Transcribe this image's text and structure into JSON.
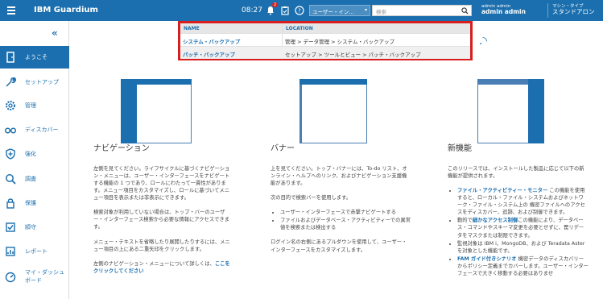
{
  "app": {
    "title": "IBM Guardium"
  },
  "topbar": {
    "time": "08:27",
    "notification_count": "2",
    "user_select_value": "ユーザー・イン…",
    "search_placeholder": "検索",
    "user_role": "admin admin",
    "user_name": "admin admin",
    "machine_type_label": "マシン・タイプ",
    "machine_type_value": "スタンドアロン"
  },
  "sidebar": {
    "items": [
      {
        "label": "ようこそ",
        "icon": "door-icon",
        "active": true
      },
      {
        "label": "セットアップ",
        "icon": "wrench-icon"
      },
      {
        "label": "管理",
        "icon": "gear-icon"
      },
      {
        "label": "ディスカバー",
        "icon": "binoculars-icon"
      },
      {
        "label": "強化",
        "icon": "shield-icon"
      },
      {
        "label": "調査",
        "icon": "magnifier-icon"
      },
      {
        "label": "保護",
        "icon": "lock-icon"
      },
      {
        "label": "順守",
        "icon": "checkbox-icon"
      },
      {
        "label": "レポート",
        "icon": "report-icon"
      },
      {
        "label": "マイ・ダッシュ",
        "label2": "ボード",
        "icon": "dashboard-icon"
      }
    ]
  },
  "popup": {
    "col_name": "NAME",
    "col_location": "LOCATION",
    "rows": [
      {
        "name": "システム・バックアップ",
        "location": "管理 > データ管理 > システム・バックアップ"
      },
      {
        "name": "パッチ・バックアップ",
        "location": "セットアップ > ツールとビュー > パッチ・バックアップ"
      }
    ]
  },
  "columns": {
    "nav": {
      "title": "ナビゲーション",
      "p1": "左側を見てください。ライフサイクルに基づくナビゲーション・メニューは、ユーザー・インターフェースをナビゲートする機能の 1 つであり、ロールにわたって一貫性があります。メニュー項目をカスタマイズし、ロールに基づいてメニュー項目を表示または非表示にできます。",
      "p2": "検索対象が利用していない場合は、トップ・バーのユーザー・インターフェース検索から必要な情報にアクセスできます。",
      "p3": "メニュー・テキストを省略したり展開したりするには、メニュー項目の上にある二重矢印をクリックします。",
      "p4": "左側のナビゲーション・メニューについて詳しくは、",
      "link": "ここをクリックしてください"
    },
    "banner": {
      "title": "バナー",
      "p1": "上を見てください。トップ・バナーには、To-do リスト、オンライン・ヘルプへのリンク、およびナビゲーション支援機能があります。",
      "p2": "次の目的で検索バーを使用します。",
      "li1": "ユーザー・インターフェースで赤撃ナビゲートする",
      "li2": "ファイルおよびデータベース・アクティビティーでの異常値を検索または検出する",
      "p3": "ログイン名の右側にあるプルダウンを使用して、ユーザー・インターフェースをカスタマイズします。"
    },
    "features": {
      "title": "新機能",
      "p1": "このリリースでは、インストールした製品に応じて以下の新機能が提供されます。",
      "li1_b": "ファイル・アクティビティー・モニター",
      "li1": " この機能を使用すると、ローカル・ファイル・システムおよびネットワーク・ファイル・システム上の 機密ファイルへのアクセスをディスカバー、追跡、および制御できます。",
      "li2_a": "動的で",
      "li2_b": "細かなアクセス制御",
      "li2": "この機能により、データベース・コマンドやスキーマ変更を必要とせずに、罠リデータをマスクまたは制限できます。",
      "li3": "監視対象は IBM i、MongoDB、および Teradata Aster を対象とした機能です。",
      "li4_b": "FAM ガイド付きシナリオ",
      "li4": " 機密データのディスカバリーからポリシー定義までカバーします。ユーザー・インターフェースで大きく移動する必要はありませ"
    }
  },
  "colors": {
    "brand": "#1c6fae",
    "highlight": "#d81e1e"
  }
}
